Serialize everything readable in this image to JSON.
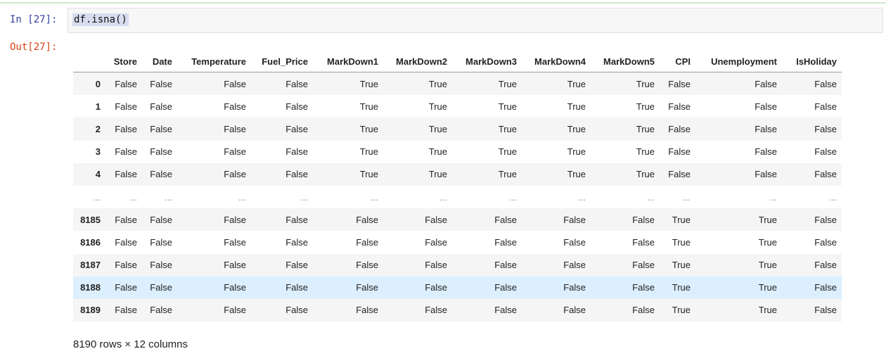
{
  "cell": {
    "input_prompt": "In [27]:",
    "code": "df.isna()",
    "output_prompt": "Out[27]:"
  },
  "dataframe": {
    "index_header": "",
    "columns": [
      "Store",
      "Date",
      "Temperature",
      "Fuel_Price",
      "MarkDown1",
      "MarkDown2",
      "MarkDown3",
      "MarkDown4",
      "MarkDown5",
      "CPI",
      "Unemployment",
      "IsHoliday"
    ],
    "rows": [
      {
        "index": "0",
        "values": [
          "False",
          "False",
          "False",
          "False",
          "True",
          "True",
          "True",
          "True",
          "True",
          "False",
          "False",
          "False"
        ]
      },
      {
        "index": "1",
        "values": [
          "False",
          "False",
          "False",
          "False",
          "True",
          "True",
          "True",
          "True",
          "True",
          "False",
          "False",
          "False"
        ]
      },
      {
        "index": "2",
        "values": [
          "False",
          "False",
          "False",
          "False",
          "True",
          "True",
          "True",
          "True",
          "True",
          "False",
          "False",
          "False"
        ]
      },
      {
        "index": "3",
        "values": [
          "False",
          "False",
          "False",
          "False",
          "True",
          "True",
          "True",
          "True",
          "True",
          "False",
          "False",
          "False"
        ]
      },
      {
        "index": "4",
        "values": [
          "False",
          "False",
          "False",
          "False",
          "True",
          "True",
          "True",
          "True",
          "True",
          "False",
          "False",
          "False"
        ]
      },
      {
        "index": "...",
        "values": [
          "...",
          "...",
          "...",
          "...",
          "...",
          "...",
          "...",
          "...",
          "...",
          "...",
          "...",
          "..."
        ]
      },
      {
        "index": "8185",
        "values": [
          "False",
          "False",
          "False",
          "False",
          "False",
          "False",
          "False",
          "False",
          "False",
          "True",
          "True",
          "False"
        ]
      },
      {
        "index": "8186",
        "values": [
          "False",
          "False",
          "False",
          "False",
          "False",
          "False",
          "False",
          "False",
          "False",
          "True",
          "True",
          "False"
        ]
      },
      {
        "index": "8187",
        "values": [
          "False",
          "False",
          "False",
          "False",
          "False",
          "False",
          "False",
          "False",
          "False",
          "True",
          "True",
          "False"
        ]
      },
      {
        "index": "8188",
        "values": [
          "False",
          "False",
          "False",
          "False",
          "False",
          "False",
          "False",
          "False",
          "False",
          "True",
          "True",
          "False"
        ]
      },
      {
        "index": "8189",
        "values": [
          "False",
          "False",
          "False",
          "False",
          "False",
          "False",
          "False",
          "False",
          "False",
          "True",
          "True",
          "False"
        ]
      }
    ],
    "highlighted_row_index": "8188",
    "shape_text": "8190 rows × 12 columns"
  },
  "colors": {
    "input_prompt": "#303f9f",
    "output_prompt": "#d84315",
    "row_highlight": "#dcefff",
    "stripe": "#f5f5f5"
  }
}
